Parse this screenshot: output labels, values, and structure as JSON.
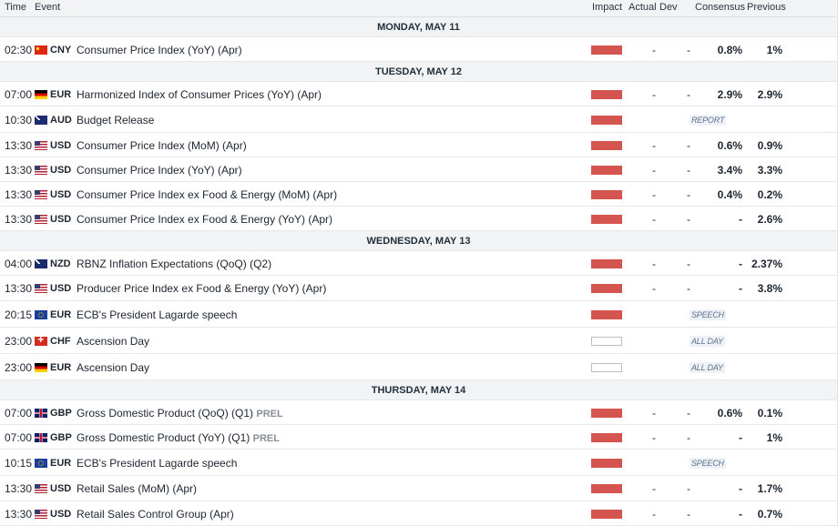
{
  "header": {
    "time": "Time",
    "event": "Event",
    "impact": "Impact",
    "actual": "Actual",
    "dev": "Dev",
    "consensus": "Consensus",
    "previous": "Previous"
  },
  "days": [
    {
      "label": "MONDAY, MAY 11",
      "events": [
        {
          "time": "02:30",
          "flag": "cn",
          "flag_icon": "flag-china-icon",
          "currency": "CNY",
          "name": "Consumer Price Index (YoY) (Apr)",
          "suffix": "",
          "impact": "high",
          "actual": "-",
          "dev": "-",
          "consensus": "0.8%",
          "previous": "1%",
          "tag": ""
        }
      ]
    },
    {
      "label": "TUESDAY, MAY 12",
      "events": [
        {
          "time": "07:00",
          "flag": "de",
          "flag_icon": "flag-germany-icon",
          "currency": "EUR",
          "name": "Harmonized Index of Consumer Prices (YoY) (Apr)",
          "suffix": "",
          "impact": "high",
          "actual": "-",
          "dev": "-",
          "consensus": "2.9%",
          "previous": "2.9%",
          "tag": ""
        },
        {
          "time": "10:30",
          "flag": "au",
          "flag_icon": "flag-australia-icon",
          "currency": "AUD",
          "name": "Budget Release",
          "suffix": "",
          "impact": "high",
          "actual": "",
          "dev": "",
          "consensus": "",
          "previous": "",
          "tag": "REPORT"
        },
        {
          "time": "13:30",
          "flag": "us",
          "flag_icon": "flag-usa-icon",
          "currency": "USD",
          "name": "Consumer Price Index (MoM) (Apr)",
          "suffix": "",
          "impact": "high",
          "actual": "-",
          "dev": "-",
          "consensus": "0.6%",
          "previous": "0.9%",
          "tag": ""
        },
        {
          "time": "13:30",
          "flag": "us",
          "flag_icon": "flag-usa-icon",
          "currency": "USD",
          "name": "Consumer Price Index (YoY) (Apr)",
          "suffix": "",
          "impact": "high",
          "actual": "-",
          "dev": "-",
          "consensus": "3.4%",
          "previous": "3.3%",
          "tag": ""
        },
        {
          "time": "13:30",
          "flag": "us",
          "flag_icon": "flag-usa-icon",
          "currency": "USD",
          "name": "Consumer Price Index ex Food & Energy (MoM) (Apr)",
          "suffix": "",
          "impact": "high",
          "actual": "-",
          "dev": "-",
          "consensus": "0.4%",
          "previous": "0.2%",
          "tag": ""
        },
        {
          "time": "13:30",
          "flag": "us",
          "flag_icon": "flag-usa-icon",
          "currency": "USD",
          "name": "Consumer Price Index ex Food & Energy (YoY) (Apr)",
          "suffix": "",
          "impact": "high",
          "actual": "-",
          "dev": "-",
          "consensus": "-",
          "previous": "2.6%",
          "tag": ""
        }
      ]
    },
    {
      "label": "WEDNESDAY, MAY 13",
      "events": [
        {
          "time": "04:00",
          "flag": "nz",
          "flag_icon": "flag-new-zealand-icon",
          "currency": "NZD",
          "name": "RBNZ Inflation Expectations (QoQ) (Q2)",
          "suffix": "",
          "impact": "high",
          "actual": "-",
          "dev": "-",
          "consensus": "-",
          "previous": "2.37%",
          "tag": ""
        },
        {
          "time": "13:30",
          "flag": "us",
          "flag_icon": "flag-usa-icon",
          "currency": "USD",
          "name": "Producer Price Index ex Food & Energy (YoY) (Apr)",
          "suffix": "",
          "impact": "high",
          "actual": "-",
          "dev": "-",
          "consensus": "-",
          "previous": "3.8%",
          "tag": ""
        },
        {
          "time": "20:15",
          "flag": "eu",
          "flag_icon": "flag-eu-icon",
          "currency": "EUR",
          "name": "ECB's President Lagarde speech",
          "suffix": "",
          "impact": "high",
          "actual": "",
          "dev": "",
          "consensus": "",
          "previous": "",
          "tag": "SPEECH"
        },
        {
          "time": "23:00",
          "flag": "ch",
          "flag_icon": "flag-switzerland-icon",
          "currency": "CHF",
          "name": "Ascension Day",
          "suffix": "",
          "impact": "low",
          "actual": "",
          "dev": "",
          "consensus": "",
          "previous": "",
          "tag": "ALL DAY"
        },
        {
          "time": "23:00",
          "flag": "de",
          "flag_icon": "flag-germany-icon",
          "currency": "EUR",
          "name": "Ascension Day",
          "suffix": "",
          "impact": "low",
          "actual": "",
          "dev": "",
          "consensus": "",
          "previous": "",
          "tag": "ALL DAY"
        }
      ]
    },
    {
      "label": "THURSDAY, MAY 14",
      "events": [
        {
          "time": "07:00",
          "flag": "gb",
          "flag_icon": "flag-uk-icon",
          "currency": "GBP",
          "name": "Gross Domestic Product (QoQ) (Q1)",
          "suffix": "PREL",
          "impact": "high",
          "actual": "-",
          "dev": "-",
          "consensus": "0.6%",
          "previous": "0.1%",
          "tag": ""
        },
        {
          "time": "07:00",
          "flag": "gb",
          "flag_icon": "flag-uk-icon",
          "currency": "GBP",
          "name": "Gross Domestic Product (YoY) (Q1)",
          "suffix": "PREL",
          "impact": "high",
          "actual": "-",
          "dev": "-",
          "consensus": "-",
          "previous": "1%",
          "tag": ""
        },
        {
          "time": "10:15",
          "flag": "eu",
          "flag_icon": "flag-eu-icon",
          "currency": "EUR",
          "name": "ECB's President Lagarde speech",
          "suffix": "",
          "impact": "high",
          "actual": "",
          "dev": "",
          "consensus": "",
          "previous": "",
          "tag": "SPEECH"
        },
        {
          "time": "13:30",
          "flag": "us",
          "flag_icon": "flag-usa-icon",
          "currency": "USD",
          "name": "Retail Sales (MoM) (Apr)",
          "suffix": "",
          "impact": "high",
          "actual": "-",
          "dev": "-",
          "consensus": "-",
          "previous": "1.7%",
          "tag": ""
        },
        {
          "time": "13:30",
          "flag": "us",
          "flag_icon": "flag-usa-icon",
          "currency": "USD",
          "name": "Retail Sales Control Group (Apr)",
          "suffix": "",
          "impact": "high",
          "actual": "-",
          "dev": "-",
          "consensus": "-",
          "previous": "0.7%",
          "tag": ""
        }
      ]
    }
  ]
}
